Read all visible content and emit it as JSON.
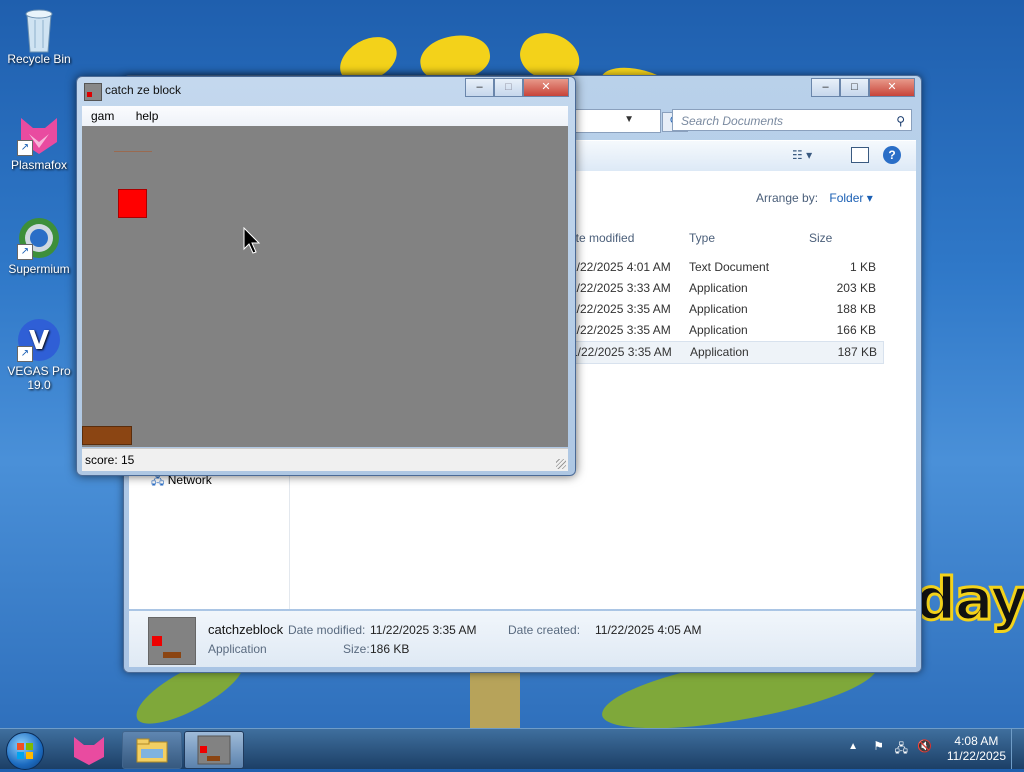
{
  "desktop": {
    "icons": [
      {
        "label": "Recycle Bin"
      },
      {
        "label": "Plasmafox"
      },
      {
        "label": "Supermium"
      },
      {
        "label": "VEGAS Pro 19.0"
      }
    ],
    "wallpaper_text": "day"
  },
  "explorer": {
    "search_placeholder": "Search Documents",
    "arrange_by_label": "Arrange by:",
    "arrange_by_value": "Folder",
    "columns": [
      "ate modified",
      "Type",
      "Size"
    ],
    "rows": [
      {
        "date": "1/22/2025 4:01 AM",
        "type": "Text Document",
        "size": "1 KB"
      },
      {
        "date": "1/22/2025 3:33 AM",
        "type": "Application",
        "size": "203 KB"
      },
      {
        "date": "1/22/2025 3:35 AM",
        "type": "Application",
        "size": "188 KB"
      },
      {
        "date": "1/22/2025 3:35 AM",
        "type": "Application",
        "size": "166 KB"
      },
      {
        "date": "1/22/2025 3:35 AM",
        "type": "Application",
        "size": "187 KB"
      }
    ],
    "nav_network": "Network",
    "details": {
      "name": "catchzeblock",
      "kind": "Application",
      "date_modified_label": "Date modified:",
      "date_modified": "11/22/2025 3:35 AM",
      "date_created_label": "Date created:",
      "date_created": "11/22/2025 4:05 AM",
      "size_label": "Size:",
      "size": "186 KB"
    }
  },
  "game": {
    "title": "catch ze block",
    "menu": [
      "gam",
      "help"
    ],
    "status": "score: 15",
    "colors": {
      "field": "#828282",
      "block": "#ff0000",
      "paddle": "#8b4513"
    }
  },
  "taskbar": {
    "time": "4:08 AM",
    "date": "11/22/2025"
  }
}
